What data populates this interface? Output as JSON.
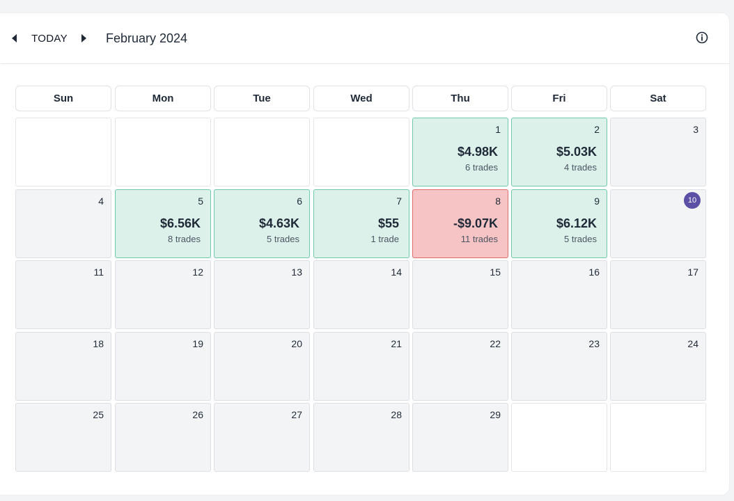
{
  "toolbar": {
    "today_label": "TODAY",
    "month_title": "February 2024",
    "prev_icon": "chevron-left-icon",
    "next_icon": "chevron-right-icon",
    "info_icon": "info-icon"
  },
  "weekdays": [
    "Sun",
    "Mon",
    "Tue",
    "Wed",
    "Thu",
    "Fri",
    "Sat"
  ],
  "colors": {
    "positive_bg": "#dcf1ea",
    "negative_bg": "#f6c4c4",
    "today_badge": "#5b4fa6"
  },
  "today": 10,
  "weeks": [
    [
      {
        "day": "",
        "empty": true
      },
      {
        "day": "",
        "empty": true
      },
      {
        "day": "",
        "empty": true
      },
      {
        "day": "",
        "empty": true
      },
      {
        "day": "1",
        "pnl": "$4.98K",
        "trades": "6 trades",
        "status": "pos"
      },
      {
        "day": "2",
        "pnl": "$5.03K",
        "trades": "4 trades",
        "status": "pos"
      },
      {
        "day": "3"
      }
    ],
    [
      {
        "day": "4"
      },
      {
        "day": "5",
        "pnl": "$6.56K",
        "trades": "8 trades",
        "status": "pos"
      },
      {
        "day": "6",
        "pnl": "$4.63K",
        "trades": "5 trades",
        "status": "pos"
      },
      {
        "day": "7",
        "pnl": "$55",
        "trades": "1 trade",
        "status": "pos"
      },
      {
        "day": "8",
        "pnl": "-$9.07K",
        "trades": "11 trades",
        "status": "neg"
      },
      {
        "day": "9",
        "pnl": "$6.12K",
        "trades": "5 trades",
        "status": "pos"
      },
      {
        "day": "10",
        "is_today": true
      }
    ],
    [
      {
        "day": "11"
      },
      {
        "day": "12"
      },
      {
        "day": "13"
      },
      {
        "day": "14"
      },
      {
        "day": "15"
      },
      {
        "day": "16"
      },
      {
        "day": "17"
      }
    ],
    [
      {
        "day": "18"
      },
      {
        "day": "19"
      },
      {
        "day": "20"
      },
      {
        "day": "21"
      },
      {
        "day": "22"
      },
      {
        "day": "23"
      },
      {
        "day": "24"
      }
    ],
    [
      {
        "day": "25"
      },
      {
        "day": "26"
      },
      {
        "day": "27"
      },
      {
        "day": "28"
      },
      {
        "day": "29"
      },
      {
        "day": "",
        "empty": true
      },
      {
        "day": "",
        "empty": true
      }
    ]
  ]
}
